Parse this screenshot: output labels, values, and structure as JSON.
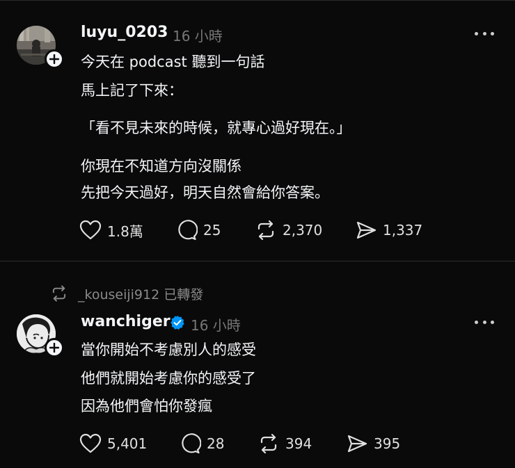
{
  "posts": [
    {
      "username": "luyu_0203",
      "time": "16 小時",
      "avatar_icon": "photo-avatar",
      "lines": [
        "今天在 podcast 聽到一句話",
        "馬上記了下來：",
        "「看不見未來的時候，就專心過好現在。」",
        "你現在不知道方向沒關係",
        "先把今天過好，明天自然會給你答案。"
      ],
      "stats": {
        "likes": "1.8萬",
        "replies": "25",
        "reposts": "2,370",
        "shares": "1,337"
      }
    },
    {
      "repost_label": "_kouseiji912 已轉發",
      "username": "wanchiger",
      "verified": true,
      "time": "16 小時",
      "avatar_icon": "illustration-avatar",
      "lines": [
        "當你開始不考慮別人的感受",
        "他們就開始考慮你的感受了",
        "因為他們會怕你發瘋"
      ],
      "stats": {
        "likes": "5,401",
        "replies": "28",
        "reposts": "394",
        "shares": "395"
      }
    }
  ],
  "colors": {
    "background": "#0a0a0a",
    "text": "#f3f5f7",
    "secondary": "#777777",
    "verified": "#0095f6"
  }
}
